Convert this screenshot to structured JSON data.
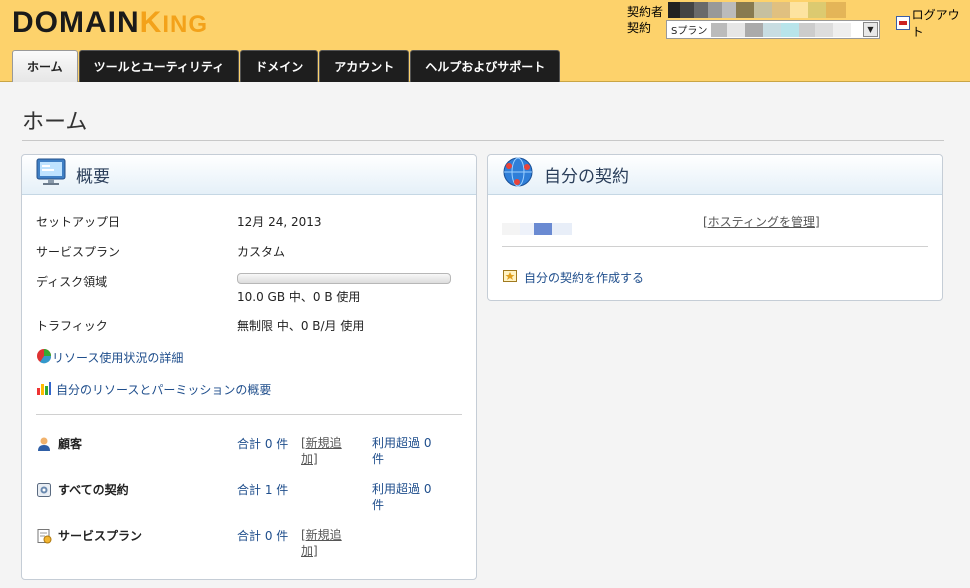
{
  "header": {
    "logo_main": "DOMAIN",
    "logo_k": "K",
    "logo_ing": "ING",
    "contractor_label": "契約者",
    "contract_label": "契約",
    "contract_selected": "Sプラン",
    "logout_label": "ログアウト"
  },
  "tabs": [
    {
      "label": "ホーム",
      "active": true
    },
    {
      "label": "ツールとユーティリティ",
      "active": false
    },
    {
      "label": "ドメイン",
      "active": false
    },
    {
      "label": "アカウント",
      "active": false
    },
    {
      "label": "ヘルプおよびサポート",
      "active": false
    }
  ],
  "page_title": "ホーム",
  "overview": {
    "title": "概要",
    "setup_label": "セットアップ日",
    "setup_value": "12月 24, 2013",
    "plan_label": "サービスプラン",
    "plan_value": "カスタム",
    "disk_label": "ディスク領域",
    "disk_usage_fraction": 0,
    "disk_value": "10.0 GB 中、0 B 使用",
    "traffic_label": "トラフィック",
    "traffic_value": "無制限 中、0 B/月 使用",
    "resource_link": "リソース使用状況の詳細",
    "permission_link": "自分のリソースとパーミッションの概要",
    "customers_label": "顧客",
    "customers_total": "合計 0 件",
    "customers_new": "[新規追加]",
    "customers_over": "利用超過 0 件",
    "subs_label": "すべての契約",
    "subs_total": "合計 1 件",
    "subs_over": "利用超過 0 件",
    "plans_label": "サービスプラン",
    "plans_total": "合計 0 件",
    "plans_new": "[新規追加]"
  },
  "my_subs": {
    "title": "自分の契約",
    "manage_link": "[ホスティングを管理]",
    "create_link": "自分の契約を作成する"
  },
  "colors": {
    "header_bg": "#fdd26b",
    "link": "#1f4e8c",
    "logo_accent": "#f3a21a"
  }
}
